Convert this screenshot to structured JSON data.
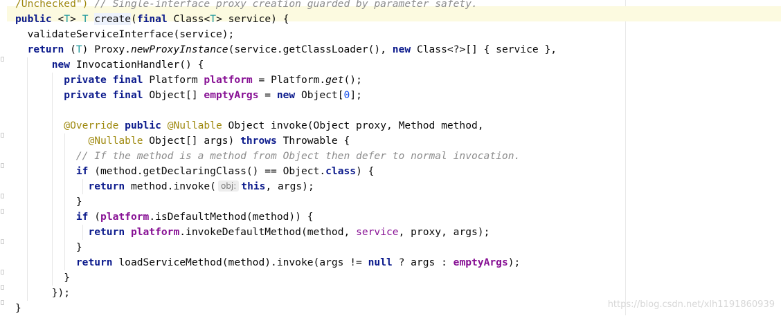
{
  "line0": {
    "annotation": "/Unchecked\")",
    "comment": "// Single-interface proxy creation guarded by parameter safety."
  },
  "line1": {
    "public": "public",
    "lt": "<",
    "T1": "T",
    "gt": ">",
    "T2": "T",
    "method": "create",
    "open": "(",
    "final": "final",
    "type": "Class<",
    "T3": "T",
    "rest": "> service) {"
  },
  "line2": {
    "text": "validateServiceInterface(service);"
  },
  "line3": {
    "return": "return",
    "p1": " (",
    "T": "T",
    "p2": ") Proxy.",
    "newProxy": "newProxyInstance",
    "p3": "(service.getClassLoader(), ",
    "new": "new",
    "p4": " Class<?>[] { service },"
  },
  "line4": {
    "new": "new",
    "rest": " InvocationHandler() {"
  },
  "line5": {
    "private": "private",
    "final": "final",
    "type": " Platform ",
    "field": "platform",
    "eq": " = Platform.",
    "get": "get",
    "end": "();"
  },
  "line6": {
    "private": "private",
    "final": "final",
    "type": " Object[] ",
    "field": "emptyArgs",
    "eq": " = ",
    "new": "new",
    "obj": " Object[",
    "zero": "0",
    "end": "];"
  },
  "line8": {
    "override": "@Override",
    "public": "public",
    "nullable": "@Nullable",
    "rest": " Object invoke(Object proxy, Method method,"
  },
  "line9": {
    "nullable": "@Nullable",
    "p1": " Object[] args) ",
    "throws": "throws",
    "p2": " Throwable {"
  },
  "line10": {
    "comment": "// If the method is a method from Object then defer to normal invocation."
  },
  "line11": {
    "if": "if",
    "p1": " (method.getDeclaringClass() == Object.",
    "class": "class",
    "p2": ") {"
  },
  "line12": {
    "return": "return",
    "p1": " method.invoke(",
    "hint": "obj:",
    "this": "this",
    "p2": ", args);"
  },
  "line13": {
    "text": "}"
  },
  "line14": {
    "if": "if",
    "p1": " (",
    "platform": "platform",
    "p2": ".isDefaultMethod(method)) {"
  },
  "line15": {
    "return": "return",
    "platform": "platform",
    "p1": ".invokeDefaultMethod(method, ",
    "service": "service",
    "p2": ", proxy, args);"
  },
  "line16": {
    "text": "}"
  },
  "line17": {
    "return": "return",
    "p1": " loadServiceMethod(method).invoke(args != ",
    "null": "null",
    "p2": " ? args : ",
    "emptyArgs": "emptyArgs",
    "p3": ");"
  },
  "line18": {
    "text": "}"
  },
  "line19": {
    "text": "});"
  },
  "line20": {
    "text": "}"
  },
  "watermark": "https://blog.csdn.net/xlh1191860939"
}
